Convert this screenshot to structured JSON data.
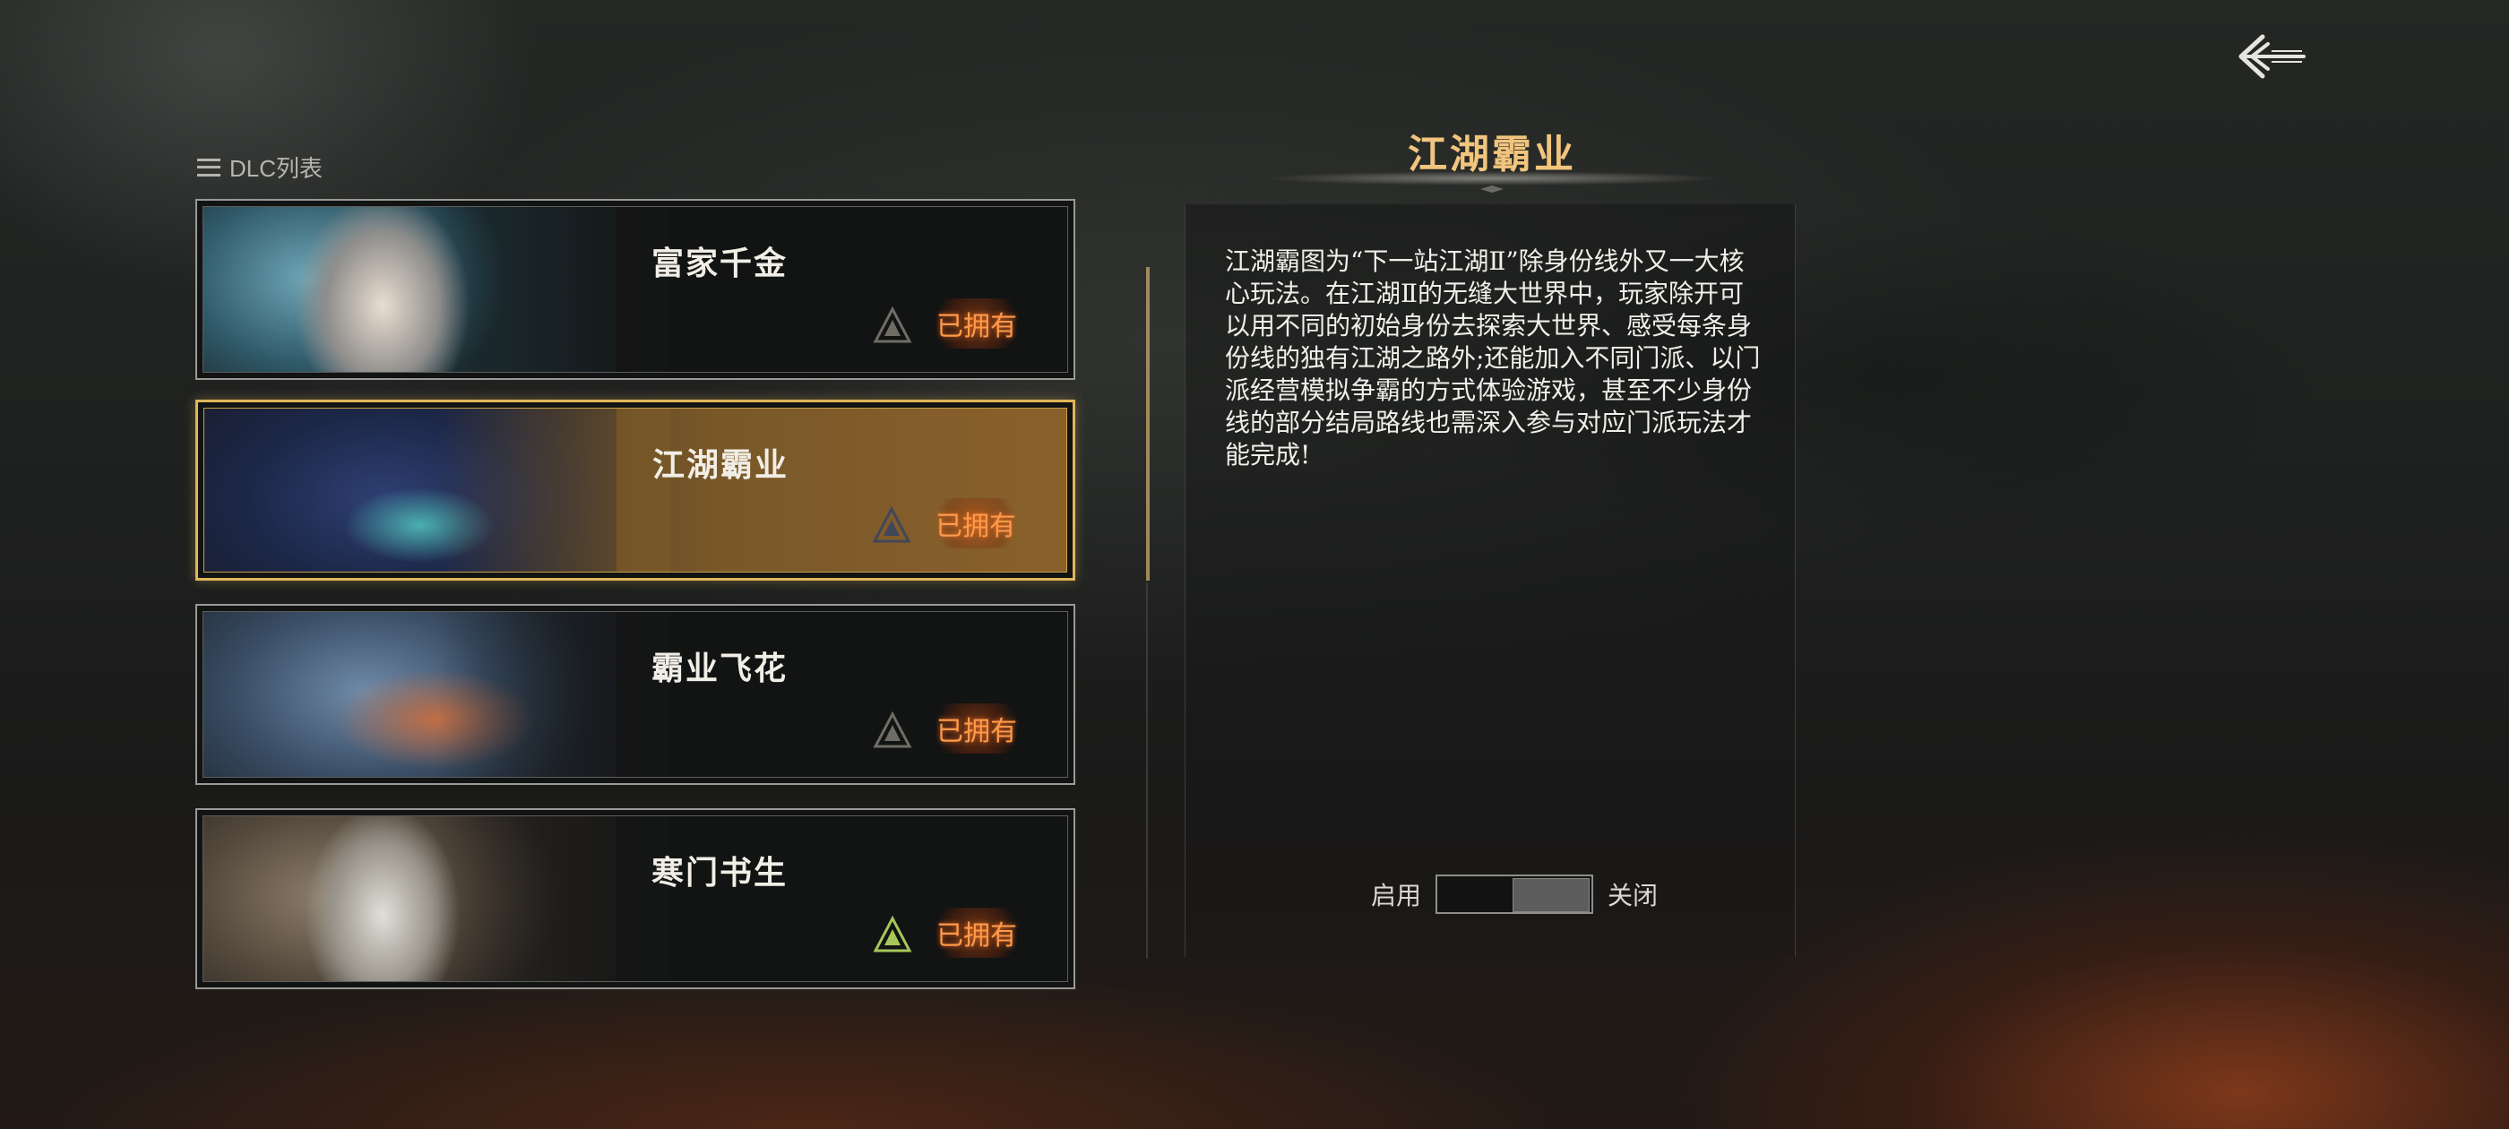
{
  "back_button": {
    "icon": "back-arrow-icon"
  },
  "dlc_list": {
    "header": "DLC列表",
    "items": [
      {
        "title": "富家千金",
        "status": "已拥有",
        "selected": false,
        "emblem_color": "#6f6c66"
      },
      {
        "title": "江湖霸业",
        "status": "已拥有",
        "selected": true,
        "emblem_color": "#41475a"
      },
      {
        "title": "霸业飞花",
        "status": "已拥有",
        "selected": false,
        "emblem_color": "#6f6c66"
      },
      {
        "title": "寒门书生",
        "status": "已拥有",
        "selected": false,
        "emblem_color": "#a7c75a"
      }
    ]
  },
  "detail": {
    "title": "江湖霸业",
    "description": "江湖霸图为“下一站江湖Ⅱ”除身份线外又一大核心玩法。在江湖Ⅱ的无缝大世界中，玩家除开可以用不同的初始身份去探索大世界、感受每条身份线的独有江湖之路外;还能加入不同门派、以门派经营模拟争霸的方式体验游戏，甚至不少身份线的部分结局路线也需深入参与对应门派玩法才能完成!",
    "toggle": {
      "on_label": "启用",
      "off_label": "关闭",
      "state": "off"
    }
  },
  "colors": {
    "accent_gold": "#e0b65a",
    "title_gold": "#f1c57d",
    "owned_orange": "#ff9a4a"
  }
}
